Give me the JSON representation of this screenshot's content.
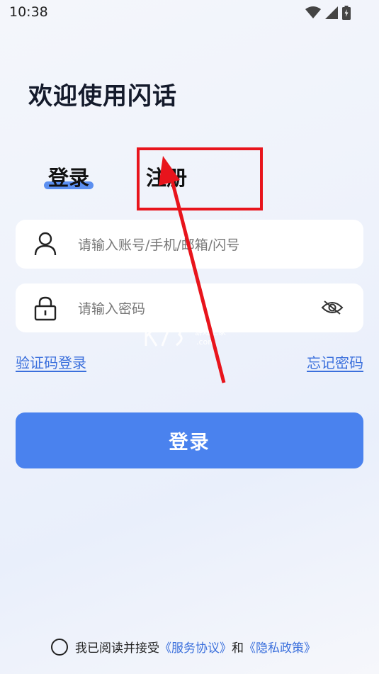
{
  "status_bar": {
    "time": "10:38"
  },
  "page": {
    "title": "欢迎使用闪话"
  },
  "tabs": {
    "login": "登录",
    "register": "注册"
  },
  "account_input": {
    "placeholder": "请输入账号/手机/邮箱/闪号",
    "value": ""
  },
  "password_input": {
    "placeholder": "请输入密码",
    "value": ""
  },
  "links": {
    "sms_login": "验证码登录",
    "forgot_password": "忘记密码"
  },
  "login_button": {
    "label": "登录"
  },
  "agreement": {
    "prefix": "我已阅读并接受",
    "service": "《服务协议》",
    "and": "和",
    "privacy": "《隐私政策》"
  },
  "watermark": {
    "text": "K73 游戏之家 .com"
  },
  "colors": {
    "accent": "#4a82ee",
    "link": "#3a6fdc",
    "annotation": "#e8141c"
  },
  "icons": {
    "account": "user-icon",
    "password": "lock-icon",
    "visibility": "eye-off-icon",
    "wifi": "wifi-icon",
    "signal": "signal-icon",
    "battery": "battery-icon"
  }
}
